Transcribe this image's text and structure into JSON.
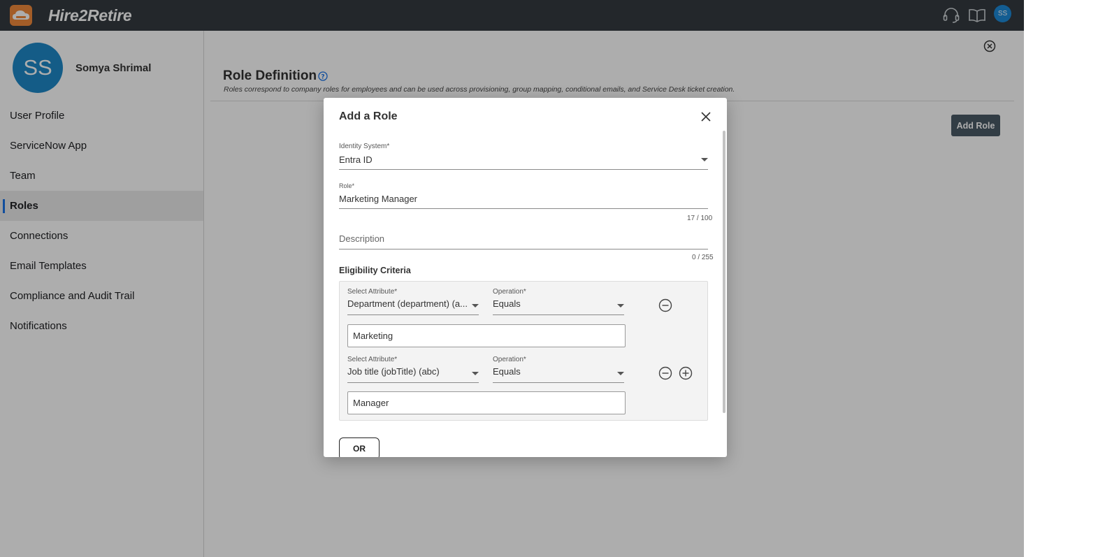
{
  "app": {
    "brand": "Hire2Retire",
    "top_avatar_initials": "SS",
    "accent_color": "#1a73e8",
    "topbar_color": "#343a40",
    "icons": [
      "support-headset-icon",
      "docs-book-icon"
    ]
  },
  "sidebar": {
    "avatar_initials": "SS",
    "user_name": "Somya Shrimal",
    "items": [
      {
        "label": "User Profile"
      },
      {
        "label": "ServiceNow App"
      },
      {
        "label": "Team"
      },
      {
        "label": "Roles",
        "active": true
      },
      {
        "label": "Connections"
      },
      {
        "label": "Email Templates"
      },
      {
        "label": "Compliance and Audit Trail"
      },
      {
        "label": "Notifications"
      }
    ]
  },
  "page": {
    "title": "Role Definition",
    "subtitle": "Roles correspond to company roles for employees and can be used across provisioning, group mapping, conditional emails, and Service Desk ticket creation.",
    "add_role_label": "Add Role"
  },
  "modal": {
    "title": "Add a Role",
    "identity_system": {
      "label": "Identity System*",
      "value": "Entra ID"
    },
    "role": {
      "label": "Role*",
      "value": "Marketing Manager",
      "counter": "17 / 100"
    },
    "description": {
      "placeholder": "Description",
      "counter": "0 / 255"
    },
    "eligibility_title": "Eligibility Criteria",
    "criteria": [
      {
        "attribute_label": "Select Attribute*",
        "attribute_value": "Department (department) (a...",
        "operation_label": "Operation*",
        "operation_value": "Equals",
        "value": "Marketing"
      },
      {
        "attribute_label": "Select Attribute*",
        "attribute_value": "Job title (jobTitle) (abc)",
        "operation_label": "Operation*",
        "operation_value": "Equals",
        "value": "Manager"
      }
    ],
    "or_label": "OR"
  }
}
